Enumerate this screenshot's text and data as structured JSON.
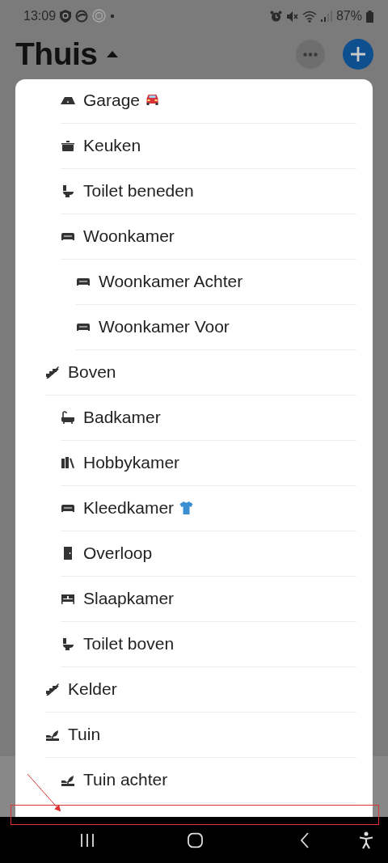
{
  "status_bar": {
    "time": "13:09",
    "battery": "87%"
  },
  "header": {
    "title": "Thuis",
    "menu_expanded": true
  },
  "room_menu": {
    "continued_children": [
      {
        "label": "Garage",
        "kind": "garage",
        "badge": {
          "kind": "car"
        }
      },
      {
        "label": "Keuken",
        "kind": "pot"
      },
      {
        "label": "Toilet beneden",
        "kind": "toilet"
      },
      {
        "label": "Woonkamer",
        "kind": "sofa",
        "children": [
          {
            "label": "Woonkamer Achter",
            "kind": "sofa"
          },
          {
            "label": "Woonkamer Voor",
            "kind": "sofa"
          }
        ]
      }
    ],
    "items": [
      {
        "label": "Boven",
        "kind": "stairs",
        "children": [
          {
            "label": "Badkamer",
            "kind": "bath"
          },
          {
            "label": "Hobbykamer",
            "kind": "books"
          },
          {
            "label": "Kleedkamer",
            "kind": "sofa",
            "badge": {
              "kind": "shirt"
            }
          },
          {
            "label": "Overloop",
            "kind": "door"
          },
          {
            "label": "Slaapkamer",
            "kind": "bed"
          },
          {
            "label": "Toilet boven",
            "kind": "toilet"
          }
        ]
      },
      {
        "label": "Kelder",
        "kind": "stairs"
      },
      {
        "label": "Tuin",
        "kind": "plant",
        "children": [
          {
            "label": "Tuin achter",
            "kind": "plant"
          }
        ]
      }
    ]
  }
}
